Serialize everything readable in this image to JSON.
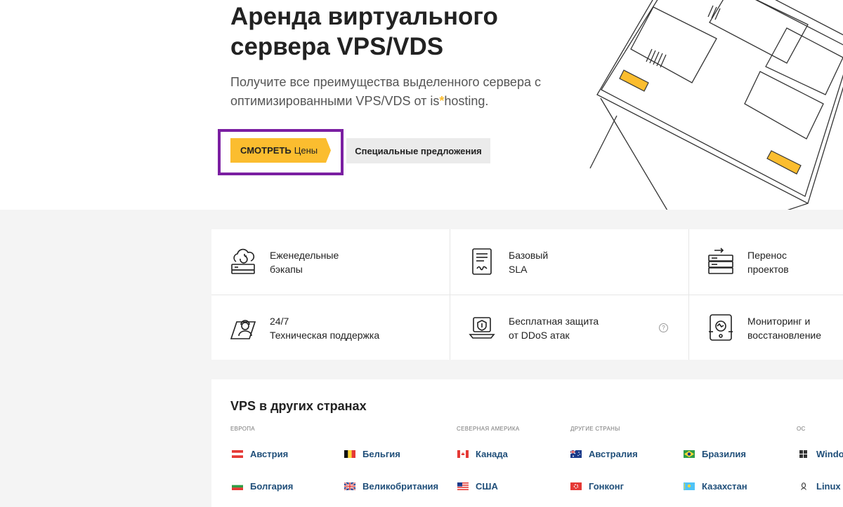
{
  "hero": {
    "title": "Аренда виртуального сервера VPS/VDS",
    "subtitle_before": "Получите все преимущества выделенного сервера с оптимизированными VPS/VDS от is",
    "subtitle_star": "*",
    "subtitle_after": "hosting.",
    "cta_bold": "СМОТРЕТЬ",
    "cta_rest": "Цены",
    "special_offers": "Специальные предложения"
  },
  "features": [
    {
      "line1": "Еженедельные",
      "line2": "бэкапы",
      "icon": "cloud-backup-icon"
    },
    {
      "line1": "Базовый",
      "line2": "SLA",
      "icon": "document-sla-icon"
    },
    {
      "line1": "Перенос",
      "line2": "проектов",
      "icon": "server-migration-icon"
    },
    {
      "line1": "24/7",
      "line2": "Техническая поддержка",
      "icon": "support-agent-icon"
    },
    {
      "line1": "Бесплатная защита",
      "line2": "от DDoS атак",
      "icon": "ddos-shield-icon"
    },
    {
      "line1": "Мониторинг и",
      "line2": "восстановление",
      "icon": "monitoring-icon"
    }
  ],
  "help_mark": "?",
  "countries": {
    "title": "VPS в других странах",
    "regions": {
      "europe": "Европа",
      "north_america": "Северная Америка",
      "other": "Другие страны",
      "os": "ОС"
    },
    "items": {
      "austria": "Австрия",
      "belgium": "Бельгия",
      "canada": "Канада",
      "australia": "Австралия",
      "brazil": "Бразилия",
      "windows": "Windows",
      "bulgaria": "Болгария",
      "uk": "Великобритания",
      "usa": "США",
      "hongkong": "Гонконг",
      "kazakhstan": "Казахстан",
      "linux": "Linux"
    }
  },
  "colors": {
    "accent": "#fbbd2f",
    "highlight": "#7b1fa2",
    "link": "#1f4e79"
  }
}
